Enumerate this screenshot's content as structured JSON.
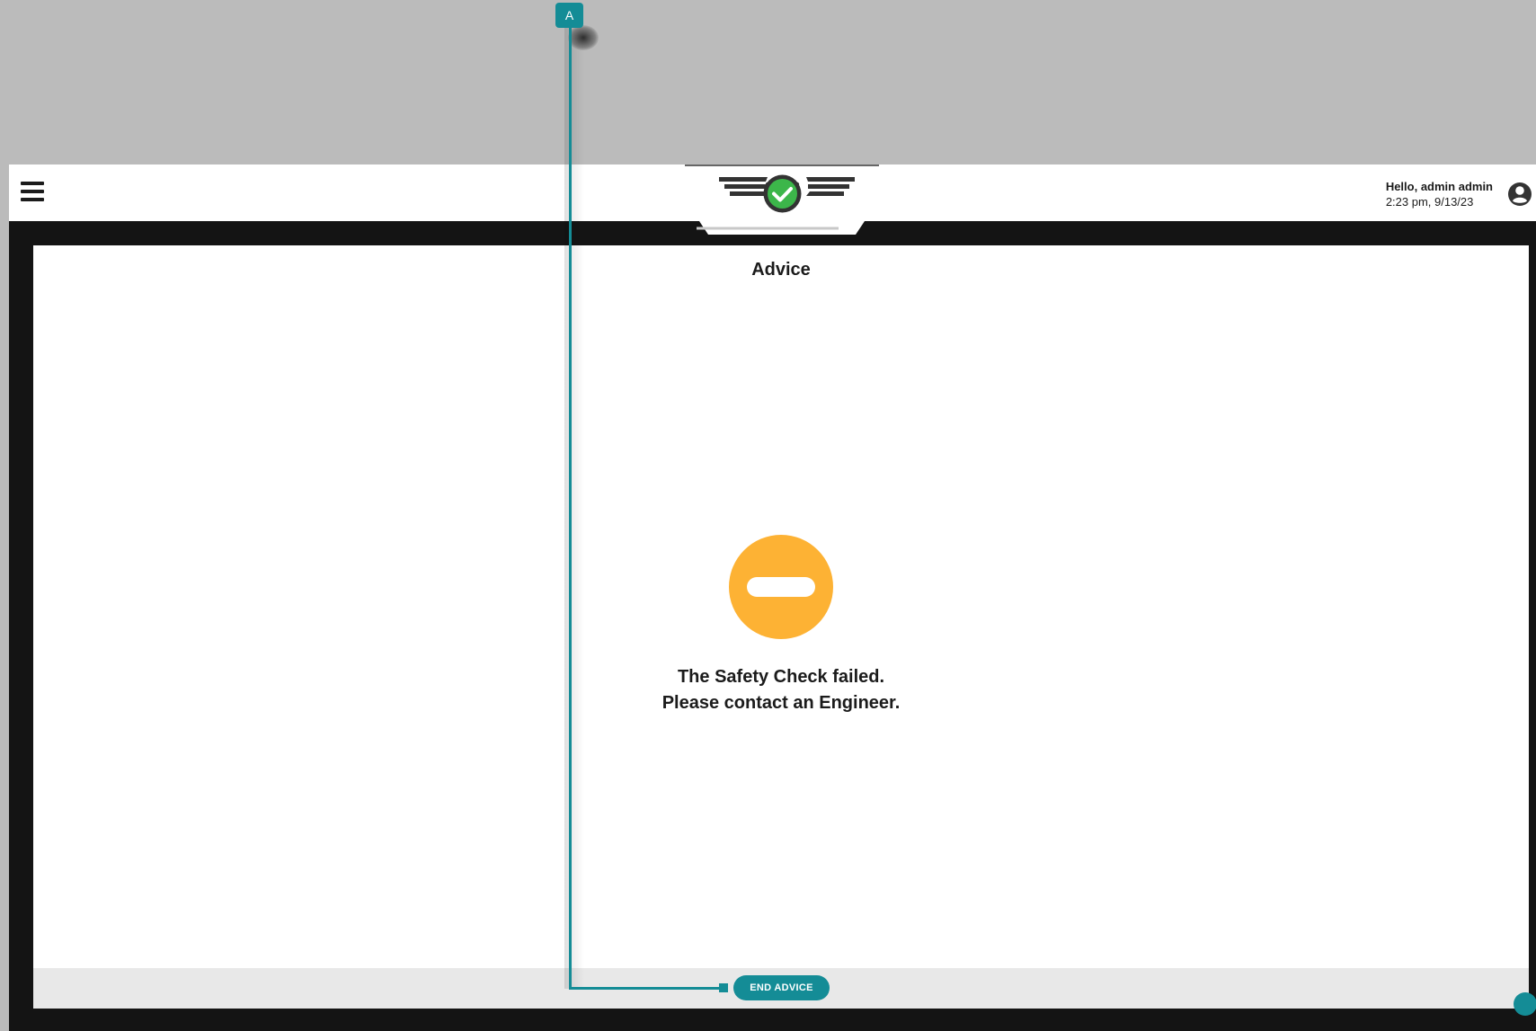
{
  "header": {
    "greeting": "Hello, admin admin",
    "timestamp": "2:23 pm, 9/13/23",
    "menu_icon": "hamburger-menu-icon",
    "user_icon": "user-account-icon",
    "logo_icon": "winged-checkmark-logo"
  },
  "panel": {
    "title": "Advice",
    "status_icon": "minus-circle-icon",
    "message_line1": "The Safety Check failed.",
    "message_line2": "Please contact an Engineer."
  },
  "footer": {
    "end_button_label": "END ADVICE"
  },
  "annotation": {
    "badge_label": "A"
  },
  "colors": {
    "backdrop": "#bbbbbb",
    "app_background": "#141414",
    "accent_teal": "#148c96",
    "warning_orange": "#fdb234",
    "logo_green": "#3cb64a",
    "text_dark": "#1b1b1b"
  }
}
